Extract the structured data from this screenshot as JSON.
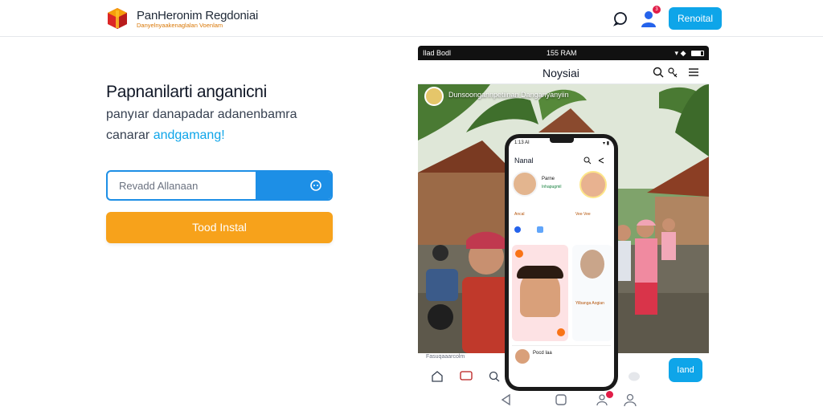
{
  "header": {
    "brand_title": "PanHeronim Regdoniai",
    "brand_tagline": "Danyelnyaakenaglalan Voenlam",
    "notification_count": "3",
    "cta_label": "Renoital",
    "colors": {
      "accent": "#0ea5e9",
      "logo_red": "#dc2626",
      "logo_orange": "#f59e0b"
    },
    "icons": [
      "logo-box-icon",
      "chat-icon",
      "user-icon"
    ]
  },
  "hero": {
    "title": "Papnanilarti anganicni",
    "line1": "panyıar danapadar adanenbamra",
    "line2_prefix": "canarar",
    "line2_accent": "andgamang!",
    "search": {
      "placeholder": "Revadd Allanaan",
      "button_icon": "search-icon"
    },
    "install_label": "Tood Instal",
    "colors": {
      "search": "#1d8fe6",
      "install": "#f7a21b"
    }
  },
  "phone": {
    "status_left": "Ilad Bodl",
    "status_time": "155 RAM",
    "app_title": "Noysiai",
    "overlay_text": "Dunsoongannpetiinan Danganyanyiin",
    "bottom_caption": "Fasuqaaarcolm",
    "bottom_button": "Iand",
    "nav_badge": "1"
  },
  "small_phone": {
    "status": "1:13 AI",
    "title": "Nanal",
    "profile1_name": "Parne",
    "profile1_sub": "Inhapugmil",
    "tiny1": "Ancal",
    "tiny2": "Vee Vee",
    "card_caption": "Yilbanga Aogian",
    "row_name": "Pocd Iaa"
  }
}
